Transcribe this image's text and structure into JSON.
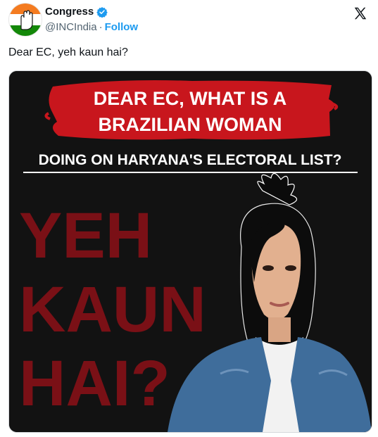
{
  "account": {
    "display_name": "Congress",
    "handle": "@INCIndia",
    "separator": "·",
    "follow_label": "Follow",
    "verified": true
  },
  "tweet": {
    "text": "Dear EC, yeh kaun hai?"
  },
  "media": {
    "headline_line1": "DEAR EC, WHAT IS A",
    "headline_line2": "BRAZILIAN WOMAN",
    "headline_line3": "DOING ON HARYANA'S ELECTORAL LIST?",
    "big_text_line1": "YEH",
    "big_text_line2": "KAUN",
    "big_text_line3": "HAI?"
  },
  "colors": {
    "accent_blue": "#1d9bf0",
    "banner_red": "#c8161d",
    "big_text_red": "#7a1016",
    "poster_bg": "#121212",
    "congress_orange": "#f47b20",
    "congress_green": "#138808"
  },
  "icons": {
    "avatar": "congress-hand-logo",
    "verified": "verified-badge-icon",
    "platform": "x-logo-icon"
  }
}
